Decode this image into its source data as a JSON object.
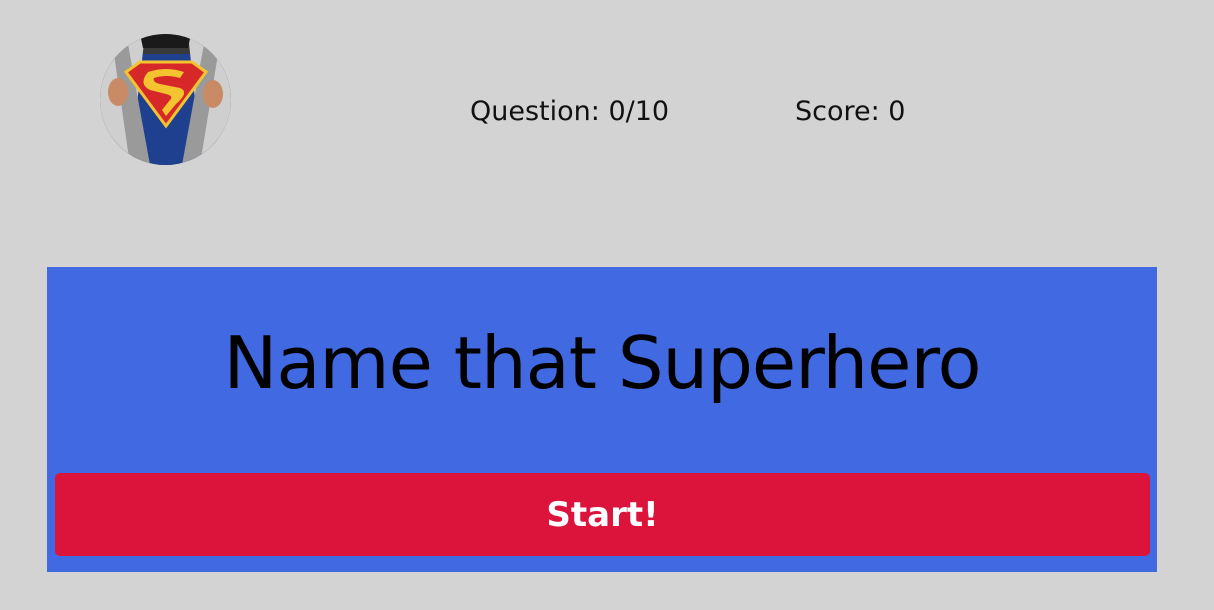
{
  "logo": {
    "icon": "superman-shield-icon",
    "colors": {
      "shield": "#d62828",
      "emblem": "#f4c430",
      "suit": "#1f3f8f"
    }
  },
  "hud": {
    "question_label": "Question: 0/10",
    "score_label": "Score: 0"
  },
  "panel": {
    "title": "Name that Superhero",
    "start_label": "Start!",
    "colors": {
      "panel": "#4169e1",
      "button": "#dc143c"
    }
  }
}
